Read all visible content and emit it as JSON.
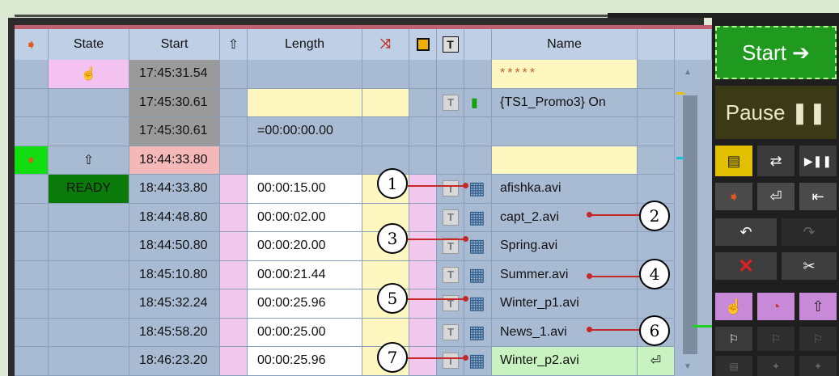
{
  "header": {
    "state": "State",
    "start": "Start",
    "length": "Length",
    "name": "Name",
    "t_badge": "T"
  },
  "rows": [
    {
      "start": "17:45:31.54",
      "length": "",
      "name": "*****",
      "state": ""
    },
    {
      "start": "17:45:30.61",
      "length": "",
      "name": "{TS1_Promo3} On",
      "state": ""
    },
    {
      "start": "17:45:30.61",
      "length": "=00:00:00.00",
      "name": "",
      "state": ""
    },
    {
      "start": "18:44:33.80",
      "length": "",
      "name": "",
      "state": ""
    },
    {
      "start": "18:44:33.80",
      "length": "00:00:15.00",
      "name": "afishka.avi",
      "state": "READY"
    },
    {
      "start": "18:44:48.80",
      "length": "00:00:02.00",
      "name": "capt_2.avi",
      "state": ""
    },
    {
      "start": "18:44:50.80",
      "length": "00:00:20.00",
      "name": "Spring.avi",
      "state": ""
    },
    {
      "start": "18:45:10.80",
      "length": "00:00:21.44",
      "name": "Summer.avi",
      "state": ""
    },
    {
      "start": "18:45:32.24",
      "length": "00:00:25.96",
      "name": "Winter_p1.avi",
      "state": ""
    },
    {
      "start": "18:45:58.20",
      "length": "00:00:25.00",
      "name": "News_1.avi",
      "state": ""
    },
    {
      "start": "18:46:23.20",
      "length": "00:00:25.96",
      "name": "Winter_p2.avi",
      "state": ""
    }
  ],
  "callouts": [
    "1",
    "2",
    "3",
    "4",
    "5",
    "6",
    "7"
  ],
  "right_panel": {
    "start_label": "Start ➔",
    "pause_label": "Pause ❚❚"
  },
  "colors": {
    "grid_bg": "#a9bbd3",
    "header_bg": "#bfd0e6",
    "start_btn": "#1e9a1e",
    "pause_btn": "#3a3a1a",
    "ready": "#0a7a0a"
  }
}
